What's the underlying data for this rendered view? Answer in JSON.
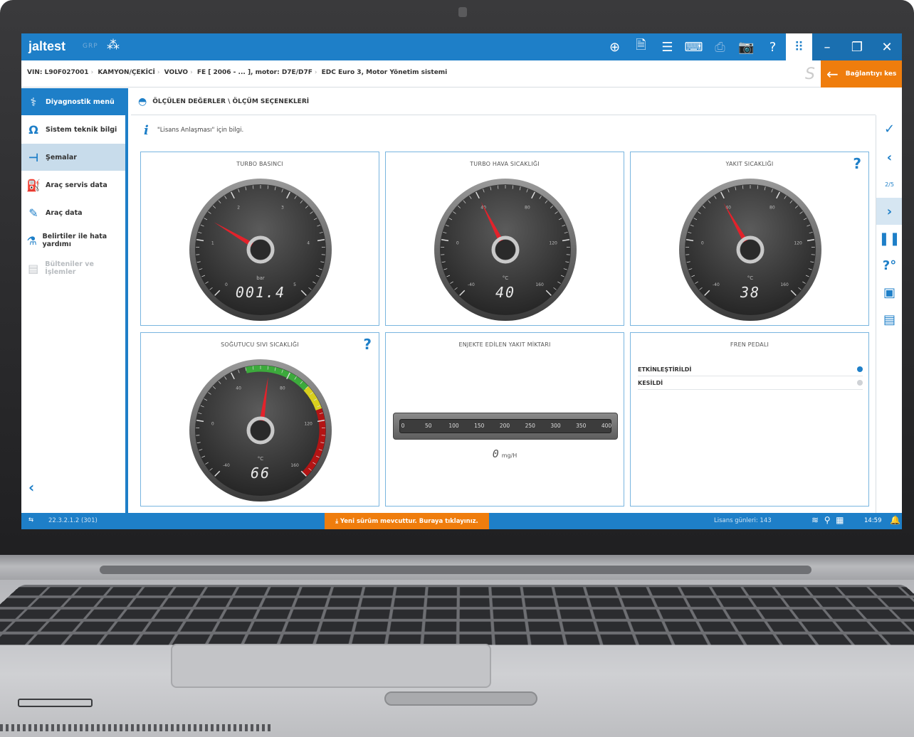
{
  "app": {
    "logo": "jaltest",
    "logo_sub": "GRP",
    "title_icons": [
      {
        "name": "language-icon",
        "glyph": "⊕"
      },
      {
        "name": "document-icon",
        "glyph": "🗎"
      },
      {
        "name": "list-icon",
        "glyph": "☰"
      },
      {
        "name": "keyboard-icon",
        "glyph": "⌨"
      },
      {
        "name": "printer-icon",
        "glyph": "⎙"
      },
      {
        "name": "camera-icon",
        "glyph": "📷"
      },
      {
        "name": "help-icon",
        "glyph": "?"
      },
      {
        "name": "apps-grid-icon",
        "glyph": "⠿"
      },
      {
        "name": "minimize-icon",
        "glyph": "–"
      },
      {
        "name": "restore-icon",
        "glyph": "❐"
      },
      {
        "name": "close-icon",
        "glyph": "✕"
      }
    ]
  },
  "breadcrumb": {
    "vin": "VIN: L90F027001",
    "category": "KAMYON/ÇEKİCİ",
    "brand": "VOLVO",
    "model": "FE [ 2006 - ... ], motor: D7E/D7F",
    "system": "EDC Euro 3, Motor Yönetim sistemi"
  },
  "disconnect_label": "Bağlantıyı kes",
  "sidebar": {
    "items": [
      {
        "label": "Diyagnostik menü",
        "state": "head"
      },
      {
        "label": "Sistem teknik bilgi",
        "state": ""
      },
      {
        "label": "Şemalar",
        "state": "sel"
      },
      {
        "label": "Araç servis data",
        "state": ""
      },
      {
        "label": "Araç data",
        "state": ""
      },
      {
        "label": "Belirtiler ile hata yardımı",
        "state": ""
      },
      {
        "label": "Bülteniler ve İşlemler",
        "state": "dis"
      }
    ],
    "collapse": "‹"
  },
  "content": {
    "title": "ÖLÇÜLEN DEĞERLER \\ ÖLÇÜM SEÇENEKLERİ",
    "info": "\"Lisans Anlaşması\" için bilgi."
  },
  "rightbar": {
    "page": "2/5"
  },
  "gauges": [
    {
      "title": "TURBO BASINCI",
      "unit": "bar",
      "readout": "001.4",
      "ticks": [
        "0",
        "1",
        "2",
        "3",
        "4",
        "5"
      ],
      "min": 0,
      "max": 5,
      "value": 1.4,
      "help": false,
      "zones": false
    },
    {
      "title": "TURBO HAVA SICAKLIĞI",
      "unit": "°C",
      "readout": "40",
      "ticks": [
        "-40",
        "0",
        "40",
        "80",
        "120",
        "160"
      ],
      "min": -40,
      "max": 160,
      "value": 40,
      "help": false,
      "zones": false
    },
    {
      "title": "YAKIT SICAKLIĞI",
      "unit": "°C",
      "readout": "38",
      "ticks": [
        "-40",
        "0",
        "40",
        "80",
        "120",
        "160"
      ],
      "min": -40,
      "max": 160,
      "value": 38,
      "help": true,
      "zones": false
    },
    {
      "title": "SOĞUTUCU SIVI SICAKLIĞI",
      "unit": "°C",
      "readout": "66",
      "ticks": [
        "-40",
        "0",
        "40",
        "80",
        "120",
        "160"
      ],
      "min": -40,
      "max": 160,
      "value": 66,
      "help": true,
      "zones": true
    }
  ],
  "fuel_bar": {
    "title": "ENJEKTE EDİLEN YAKIT MİKTARI",
    "ticks": [
      "0",
      "50",
      "100",
      "150",
      "200",
      "250",
      "300",
      "350",
      "400"
    ],
    "min": 0,
    "max": 400,
    "value": 0,
    "readout": "0",
    "unit": "mg/H"
  },
  "brake": {
    "title": "FREN PEDALI",
    "rows": [
      {
        "label": "ETKİNLEŞTİRİLDİ",
        "active": true
      },
      {
        "label": "KESİLDİ",
        "active": false
      }
    ]
  },
  "status": {
    "version": "22.3.2.1.2 (301)",
    "update": "Yeni sürüm mevcuttur. Buraya tıklayınız.",
    "license": "Lisans günleri: 143",
    "time": "14:59"
  },
  "colors": {
    "primary": "#1e7fc8",
    "accent": "#ef7d0d",
    "needle": "#e3222b",
    "zone_green": "#3caa3c",
    "zone_yellow": "#d8cf1e",
    "zone_red": "#b31414"
  }
}
